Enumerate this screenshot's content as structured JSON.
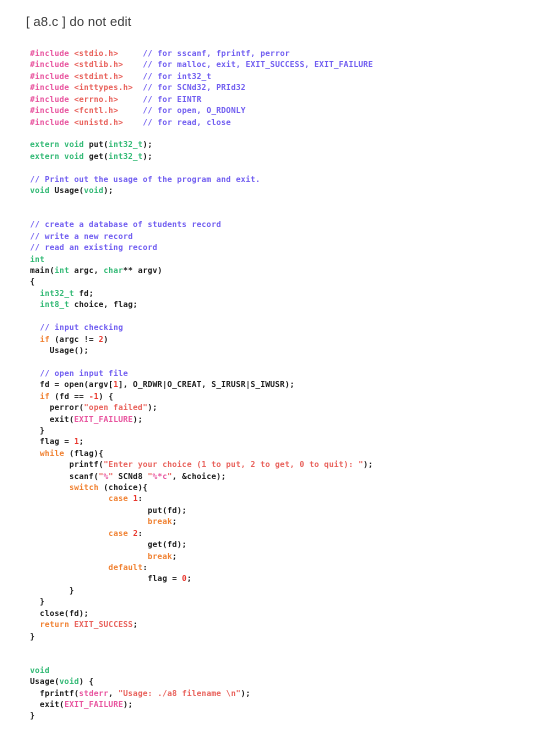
{
  "heading": {
    "text": "[ a8.c ] do not edit",
    "color": "#3c3c3c"
  },
  "colors": {
    "background": "#ffffff",
    "plain": "#1a1a1a",
    "preprocessor": "#e8539e",
    "header_name": "#e8605a",
    "comment": "#6f5cf0",
    "keyword": "#f08030",
    "type": "#2eb872",
    "number": "#e8352b",
    "string": "#e8605a",
    "format_spec": "#e8539e",
    "macro": "#e8539e"
  },
  "code": {
    "language": "c",
    "filename": "a8.c",
    "lines": [
      "#include <stdio.h>     // for sscanf, fprintf, perror",
      "#include <stdlib.h>    // for malloc, exit, EXIT_SUCCESS, EXIT_FAILURE",
      "#include <stdint.h>    // for int32_t",
      "#include <inttypes.h>  // for SCNd32, PRId32",
      "#include <errno.h>     // for EINTR",
      "#include <fcntl.h>     // for open, O_RDONLY",
      "#include <unistd.h>    // for read, close",
      "",
      "extern void put(int32_t);",
      "extern void get(int32_t);",
      "",
      "// Print out the usage of the program and exit.",
      "void Usage(void);",
      "",
      "",
      "// create a database of students record",
      "// write a new record",
      "// read an existing record",
      "int",
      "main(int argc, char** argv)",
      "{",
      "  int32_t fd;",
      "  int8_t choice, flag;",
      "",
      "  // input checking",
      "  if (argc != 2)",
      "    Usage();",
      "",
      "  // open input file",
      "  fd = open(argv[1], O_RDWR|O_CREAT, S_IRUSR|S_IWUSR);",
      "  if (fd == -1) {",
      "    perror(\"open failed\");",
      "    exit(EXIT_FAILURE);",
      "  }",
      "  flag = 1;",
      "  while (flag){",
      "        printf(\"Enter your choice (1 to put, 2 to get, 0 to quit): \");",
      "        scanf(\"%\" SCNd8 \"%*c\", &choice);",
      "        switch (choice){",
      "                case 1:",
      "                        put(fd);",
      "                        break;",
      "                case 2:",
      "                        get(fd);",
      "                        break;",
      "                default:",
      "                        flag = 0;",
      "        }",
      "  }",
      "  close(fd);",
      "  return EXIT_SUCCESS;",
      "}",
      "",
      "",
      "void",
      "Usage(void) {",
      "  fprintf(stderr, \"Usage: ./a8 filename \\n\");",
      "  exit(EXIT_FAILURE);",
      "}"
    ],
    "tokens": [
      [
        {
          "t": "#include",
          "c": "pp"
        },
        {
          "t": " ",
          "c": "pl"
        },
        {
          "t": "<stdio.h>",
          "c": "hdr"
        },
        {
          "t": "     ",
          "c": "pl"
        },
        {
          "t": "// for sscanf, fprintf, perror",
          "c": "cm"
        }
      ],
      [
        {
          "t": "#include",
          "c": "pp"
        },
        {
          "t": " ",
          "c": "pl"
        },
        {
          "t": "<stdlib.h>",
          "c": "hdr"
        },
        {
          "t": "    ",
          "c": "pl"
        },
        {
          "t": "// for malloc, exit, EXIT_SUCCESS, EXIT_FAILURE",
          "c": "cm"
        }
      ],
      [
        {
          "t": "#include",
          "c": "pp"
        },
        {
          "t": " ",
          "c": "pl"
        },
        {
          "t": "<stdint.h>",
          "c": "hdr"
        },
        {
          "t": "    ",
          "c": "pl"
        },
        {
          "t": "// for int32_t",
          "c": "cm"
        }
      ],
      [
        {
          "t": "#include",
          "c": "pp"
        },
        {
          "t": " ",
          "c": "pl"
        },
        {
          "t": "<inttypes.h>",
          "c": "hdr"
        },
        {
          "t": "  ",
          "c": "pl"
        },
        {
          "t": "// for SCNd32, PRId32",
          "c": "cm"
        }
      ],
      [
        {
          "t": "#include",
          "c": "pp"
        },
        {
          "t": " ",
          "c": "pl"
        },
        {
          "t": "<errno.h>",
          "c": "hdr"
        },
        {
          "t": "     ",
          "c": "pl"
        },
        {
          "t": "// for EINTR",
          "c": "cm"
        }
      ],
      [
        {
          "t": "#include",
          "c": "pp"
        },
        {
          "t": " ",
          "c": "pl"
        },
        {
          "t": "<fcntl.h>",
          "c": "hdr"
        },
        {
          "t": "     ",
          "c": "pl"
        },
        {
          "t": "// for open, O_RDONLY",
          "c": "cm"
        }
      ],
      [
        {
          "t": "#include",
          "c": "pp"
        },
        {
          "t": " ",
          "c": "pl"
        },
        {
          "t": "<unistd.h>",
          "c": "hdr"
        },
        {
          "t": "    ",
          "c": "pl"
        },
        {
          "t": "// for read, close",
          "c": "cm"
        }
      ],
      [],
      [
        {
          "t": "extern void ",
          "c": "ty"
        },
        {
          "t": "put(",
          "c": "pl"
        },
        {
          "t": "int32_t",
          "c": "ty"
        },
        {
          "t": ");",
          "c": "pl"
        }
      ],
      [
        {
          "t": "extern void ",
          "c": "ty"
        },
        {
          "t": "get(",
          "c": "pl"
        },
        {
          "t": "int32_t",
          "c": "ty"
        },
        {
          "t": ");",
          "c": "pl"
        }
      ],
      [],
      [
        {
          "t": "// Print out the usage of the program and exit.",
          "c": "cm"
        }
      ],
      [
        {
          "t": "void ",
          "c": "ty"
        },
        {
          "t": "Usage(",
          "c": "pl"
        },
        {
          "t": "void",
          "c": "ty"
        },
        {
          "t": ");",
          "c": "pl"
        }
      ],
      [],
      [],
      [
        {
          "t": "// create a database of students record",
          "c": "cm"
        }
      ],
      [
        {
          "t": "// write a new record",
          "c": "cm"
        }
      ],
      [
        {
          "t": "// read an existing record",
          "c": "cm"
        }
      ],
      [
        {
          "t": "int",
          "c": "ty"
        }
      ],
      [
        {
          "t": "main(",
          "c": "pl"
        },
        {
          "t": "int",
          "c": "ty"
        },
        {
          "t": " argc, ",
          "c": "pl"
        },
        {
          "t": "char",
          "c": "ty"
        },
        {
          "t": "** argv)",
          "c": "pl"
        }
      ],
      [
        {
          "t": "{",
          "c": "pl"
        }
      ],
      [
        {
          "t": "  ",
          "c": "pl"
        },
        {
          "t": "int32_t",
          "c": "ty"
        },
        {
          "t": " fd;",
          "c": "pl"
        }
      ],
      [
        {
          "t": "  ",
          "c": "pl"
        },
        {
          "t": "int8_t",
          "c": "ty"
        },
        {
          "t": " choice, flag;",
          "c": "pl"
        }
      ],
      [],
      [
        {
          "t": "  ",
          "c": "pl"
        },
        {
          "t": "// input checking",
          "c": "cm"
        }
      ],
      [
        {
          "t": "  ",
          "c": "pl"
        },
        {
          "t": "if",
          "c": "kw"
        },
        {
          "t": " (argc != ",
          "c": "pl"
        },
        {
          "t": "2",
          "c": "num"
        },
        {
          "t": ")",
          "c": "pl"
        }
      ],
      [
        {
          "t": "    Usage();",
          "c": "pl"
        }
      ],
      [],
      [
        {
          "t": "  ",
          "c": "pl"
        },
        {
          "t": "// open input file",
          "c": "cm"
        }
      ],
      [
        {
          "t": "  fd = open(argv[",
          "c": "pl"
        },
        {
          "t": "1",
          "c": "num"
        },
        {
          "t": "], O_RDWR|O_CREAT, S_IRUSR|S_IWUSR);",
          "c": "pl"
        }
      ],
      [
        {
          "t": "  ",
          "c": "pl"
        },
        {
          "t": "if",
          "c": "kw"
        },
        {
          "t": " (fd == ",
          "c": "pl"
        },
        {
          "t": "-1",
          "c": "num"
        },
        {
          "t": ") {",
          "c": "pl"
        }
      ],
      [
        {
          "t": "    perror(",
          "c": "pl"
        },
        {
          "t": "\"open failed\"",
          "c": "str"
        },
        {
          "t": ");",
          "c": "pl"
        }
      ],
      [
        {
          "t": "    exit(",
          "c": "pl"
        },
        {
          "t": "EXIT_FAILURE",
          "c": "mac"
        },
        {
          "t": ");",
          "c": "pl"
        }
      ],
      [
        {
          "t": "  }",
          "c": "pl"
        }
      ],
      [
        {
          "t": "  flag = ",
          "c": "pl"
        },
        {
          "t": "1",
          "c": "num"
        },
        {
          "t": ";",
          "c": "pl"
        }
      ],
      [
        {
          "t": "  ",
          "c": "pl"
        },
        {
          "t": "while",
          "c": "kw"
        },
        {
          "t": " (flag){",
          "c": "pl"
        }
      ],
      [
        {
          "t": "        printf(",
          "c": "pl"
        },
        {
          "t": "\"Enter your choice (1 to put, 2 to get, 0 to quit): \"",
          "c": "str"
        },
        {
          "t": ");",
          "c": "pl"
        }
      ],
      [
        {
          "t": "        scanf(",
          "c": "pl"
        },
        {
          "t": "\"",
          "c": "str"
        },
        {
          "t": "%",
          "c": "fmt"
        },
        {
          "t": "\"",
          "c": "str"
        },
        {
          "t": " SCNd8 ",
          "c": "pl"
        },
        {
          "t": "\"",
          "c": "str"
        },
        {
          "t": "%*c",
          "c": "fmt"
        },
        {
          "t": "\"",
          "c": "str"
        },
        {
          "t": ", &choice);",
          "c": "pl"
        }
      ],
      [
        {
          "t": "        ",
          "c": "pl"
        },
        {
          "t": "switch",
          "c": "kw"
        },
        {
          "t": " (choice){",
          "c": "pl"
        }
      ],
      [
        {
          "t": "                ",
          "c": "pl"
        },
        {
          "t": "case",
          "c": "kw"
        },
        {
          "t": " ",
          "c": "pl"
        },
        {
          "t": "1",
          "c": "num"
        },
        {
          "t": ":",
          "c": "pl"
        }
      ],
      [
        {
          "t": "                        put(fd);",
          "c": "pl"
        }
      ],
      [
        {
          "t": "                        ",
          "c": "pl"
        },
        {
          "t": "break",
          "c": "kw"
        },
        {
          "t": ";",
          "c": "pl"
        }
      ],
      [
        {
          "t": "                ",
          "c": "pl"
        },
        {
          "t": "case",
          "c": "kw"
        },
        {
          "t": " ",
          "c": "pl"
        },
        {
          "t": "2",
          "c": "num"
        },
        {
          "t": ":",
          "c": "pl"
        }
      ],
      [
        {
          "t": "                        get(fd);",
          "c": "pl"
        }
      ],
      [
        {
          "t": "                        ",
          "c": "pl"
        },
        {
          "t": "break",
          "c": "kw"
        },
        {
          "t": ";",
          "c": "pl"
        }
      ],
      [
        {
          "t": "                ",
          "c": "pl"
        },
        {
          "t": "default",
          "c": "kw"
        },
        {
          "t": ":",
          "c": "pl"
        }
      ],
      [
        {
          "t": "                        flag = ",
          "c": "pl"
        },
        {
          "t": "0",
          "c": "num"
        },
        {
          "t": ";",
          "c": "pl"
        }
      ],
      [
        {
          "t": "        }",
          "c": "pl"
        }
      ],
      [
        {
          "t": "  }",
          "c": "pl"
        }
      ],
      [
        {
          "t": "  close(fd);",
          "c": "pl"
        }
      ],
      [
        {
          "t": "  ",
          "c": "pl"
        },
        {
          "t": "return",
          "c": "kw"
        },
        {
          "t": " ",
          "c": "pl"
        },
        {
          "t": "EXIT_SUCCESS",
          "c": "mac2"
        },
        {
          "t": ";",
          "c": "pl"
        }
      ],
      [
        {
          "t": "}",
          "c": "pl"
        }
      ],
      [],
      [],
      [
        {
          "t": "void",
          "c": "ty"
        }
      ],
      [
        {
          "t": "Usage(",
          "c": "pl"
        },
        {
          "t": "void",
          "c": "ty"
        },
        {
          "t": ") {",
          "c": "pl"
        }
      ],
      [
        {
          "t": "  fprintf(",
          "c": "pl"
        },
        {
          "t": "stderr",
          "c": "mac"
        },
        {
          "t": ", ",
          "c": "pl"
        },
        {
          "t": "\"Usage: ./a8 filename \\n\"",
          "c": "str"
        },
        {
          "t": ");",
          "c": "pl"
        }
      ],
      [
        {
          "t": "  exit(",
          "c": "pl"
        },
        {
          "t": "EXIT_FAILURE",
          "c": "mac"
        },
        {
          "t": ");",
          "c": "pl"
        }
      ],
      [
        {
          "t": "}",
          "c": "pl"
        }
      ]
    ]
  }
}
